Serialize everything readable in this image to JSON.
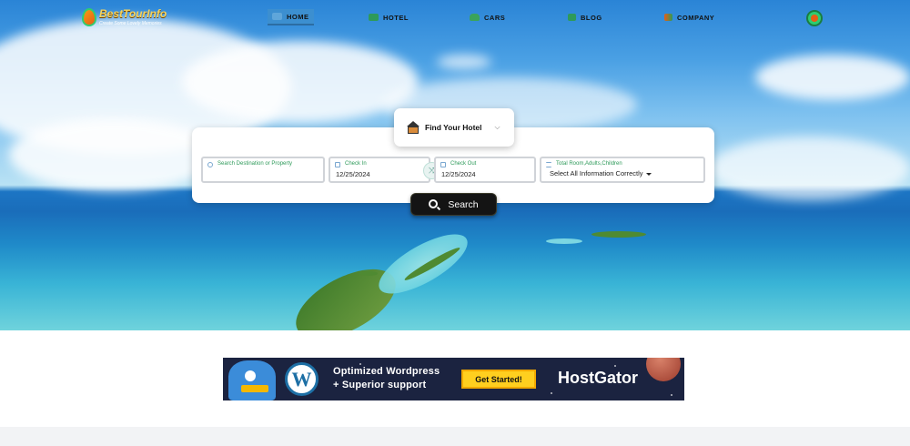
{
  "logo": {
    "name": "BestTourInfo",
    "tagline": "Create Some Lovely Memories"
  },
  "nav": [
    {
      "label": "HOME",
      "icon": "home-icon",
      "active": true
    },
    {
      "label": "HOTEL",
      "icon": "bed-icon",
      "active": false
    },
    {
      "label": "CARS",
      "icon": "car-icon",
      "active": false
    },
    {
      "label": "BLOG",
      "icon": "blog-icon",
      "active": false
    },
    {
      "label": "COMPANY",
      "icon": "company-icon",
      "active": false
    }
  ],
  "search": {
    "tab_label": "Find Your Hotel",
    "destination_placeholder": "Search Destination or Property",
    "checkin_label": "Check In",
    "checkin_value": "12/25/2024",
    "checkout_label": "Check Out",
    "checkout_value": "12/25/2024",
    "guests_label": "Total Room,Adults,Children",
    "guests_value": "Select All Information Correctly",
    "button_label": "Search"
  },
  "ad": {
    "line1": "Optimized  Wordpress",
    "line2": "+ Superior support",
    "button": "Get Started!",
    "brand": "HostGator",
    "wp_glyph": "W"
  },
  "colors": {
    "accent_green": "#2e9a5a",
    "nav_active": "#3c8fd0",
    "ad_bg": "#1b2340",
    "ad_button": "#ffcf1f"
  }
}
